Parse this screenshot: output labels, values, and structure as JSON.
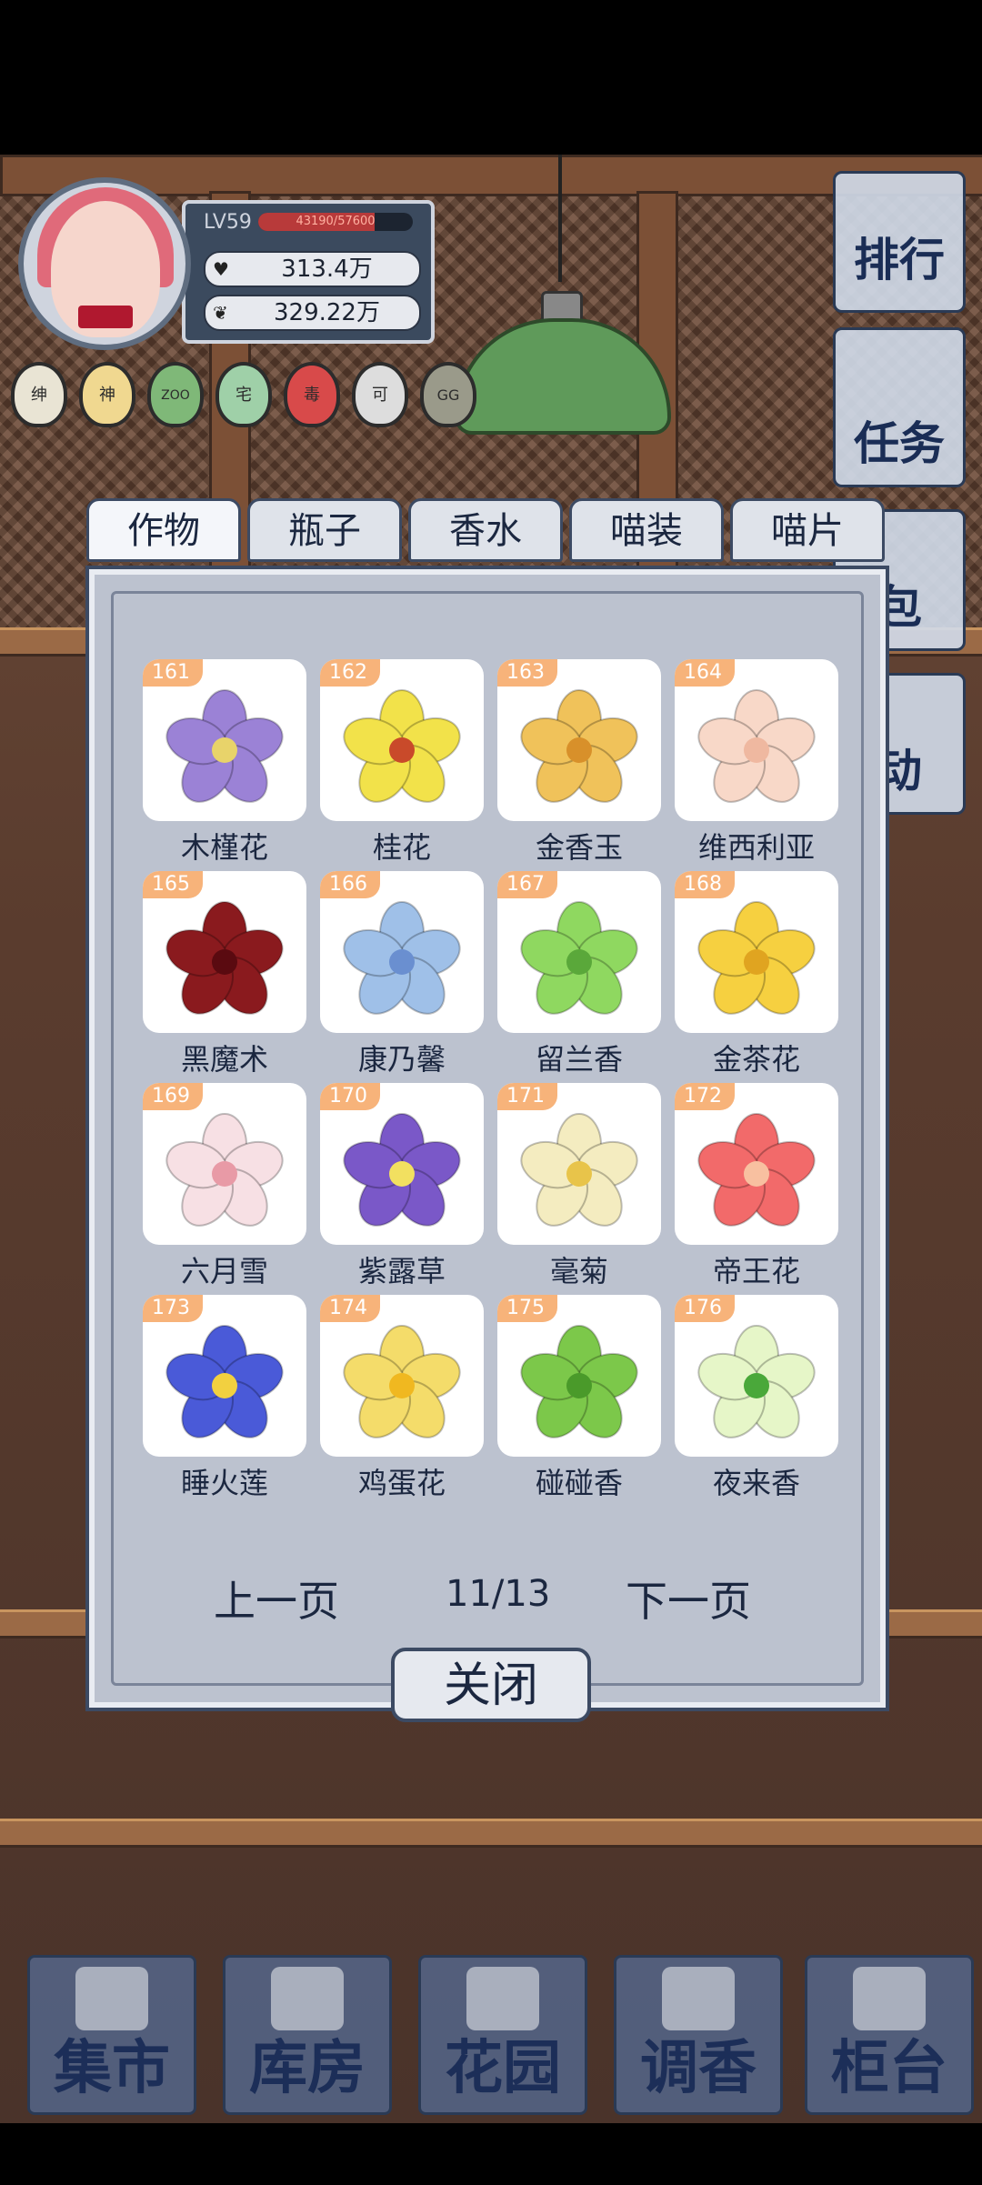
{
  "player": {
    "level": "LV59",
    "xp_text": "43190/57600",
    "xp_fraction": 0.75,
    "stat1": "313.4万",
    "stat2": "329.22万"
  },
  "badges": [
    "绅",
    "神",
    "ZOO",
    "宅",
    "毒",
    "可",
    "GG"
  ],
  "side_menu": [
    "排行",
    "任务",
    "包",
    "动"
  ],
  "tabs": [
    "作物",
    "瓶子",
    "香水",
    "喵装",
    "喵片"
  ],
  "items": [
    {
      "num": "161",
      "name": "木槿花",
      "color": "#9b82d6",
      "center": "#e8d36a"
    },
    {
      "num": "162",
      "name": "桂花",
      "color": "#f2e24a",
      "center": "#c94a2a"
    },
    {
      "num": "163",
      "name": "金香玉",
      "color": "#f0c25a",
      "center": "#d8902a"
    },
    {
      "num": "164",
      "name": "维西利亚",
      "color": "#f8d8c8",
      "center": "#efb8a0"
    },
    {
      "num": "165",
      "name": "黑魔术",
      "color": "#8a1a1e",
      "center": "#5a0a10"
    },
    {
      "num": "166",
      "name": "康乃馨",
      "color": "#9fc0e8",
      "center": "#6a8fd0"
    },
    {
      "num": "167",
      "name": "留兰香",
      "color": "#8fd860",
      "center": "#5aa83a"
    },
    {
      "num": "168",
      "name": "金茶花",
      "color": "#f6d040",
      "center": "#e0a420"
    },
    {
      "num": "169",
      "name": "六月雪",
      "color": "#f7e0e4",
      "center": "#e89aa6"
    },
    {
      "num": "170",
      "name": "紫露草",
      "color": "#7a58c8",
      "center": "#f2e060"
    },
    {
      "num": "171",
      "name": "毫菊",
      "color": "#f4ecc0",
      "center": "#e8c44a"
    },
    {
      "num": "172",
      "name": "帝王花",
      "color": "#f26a6a",
      "center": "#f8c0a0"
    },
    {
      "num": "173",
      "name": "睡火莲",
      "color": "#4a5ad8",
      "center": "#f2d040"
    },
    {
      "num": "174",
      "name": "鸡蛋花",
      "color": "#f4dc6a",
      "center": "#f0b820"
    },
    {
      "num": "175",
      "name": "碰碰香",
      "color": "#7cc84a",
      "center": "#4a9a2a"
    },
    {
      "num": "176",
      "name": "夜来香",
      "color": "#e6f6c8",
      "center": "#4aa83a"
    }
  ],
  "pager": {
    "prev": "上一页",
    "page": "11/13",
    "next": "下一页"
  },
  "close_label": "关闭",
  "bottom_nav": [
    "集市",
    "库房",
    "花园",
    "调香",
    "柜台"
  ]
}
